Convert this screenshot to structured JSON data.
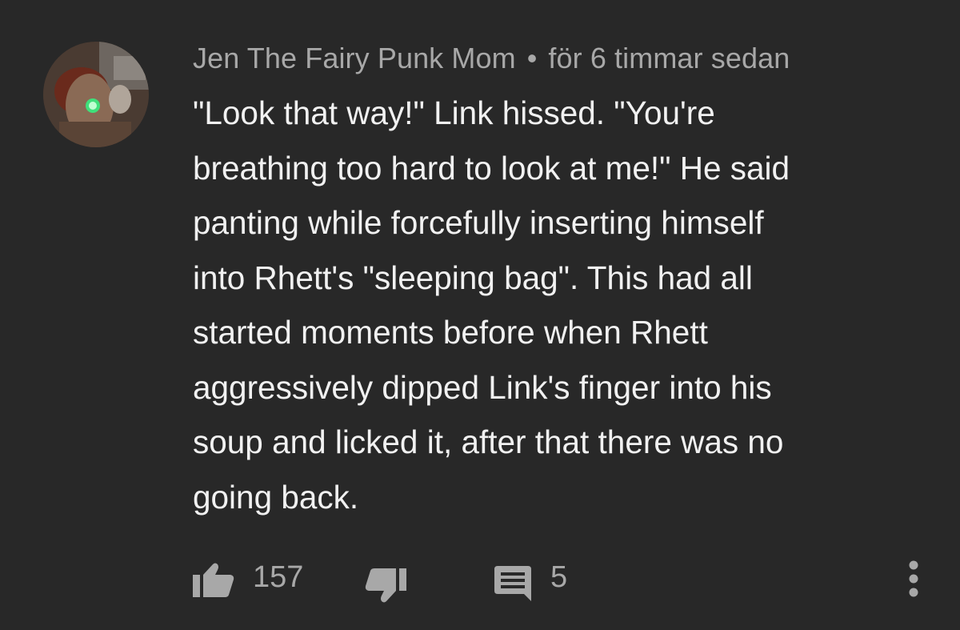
{
  "comment": {
    "author": "Jen The Fairy Punk Mom",
    "separator": "•",
    "timestamp": "för 6 timmar sedan",
    "text_lines": [
      "\"Look that way!\" Link hissed. \"You're",
      "breathing too hard to look at me!\" He said",
      "panting while forcefully inserting himself",
      "into Rhett's \"sleeping bag\". This had all",
      "started moments before when Rhett",
      "aggressively dipped Link's finger into his",
      "soup and licked it, after that there was no",
      "going back."
    ]
  },
  "actions": {
    "like_count": "157",
    "reply_count": "5"
  },
  "icons": {
    "like": "thumbs-up-icon",
    "dislike": "thumbs-down-icon",
    "reply": "comment-icon",
    "menu": "more-vert-icon"
  },
  "colors": {
    "background": "#282828",
    "text_primary": "#f1f1f1",
    "text_secondary": "#a8a8a8"
  }
}
